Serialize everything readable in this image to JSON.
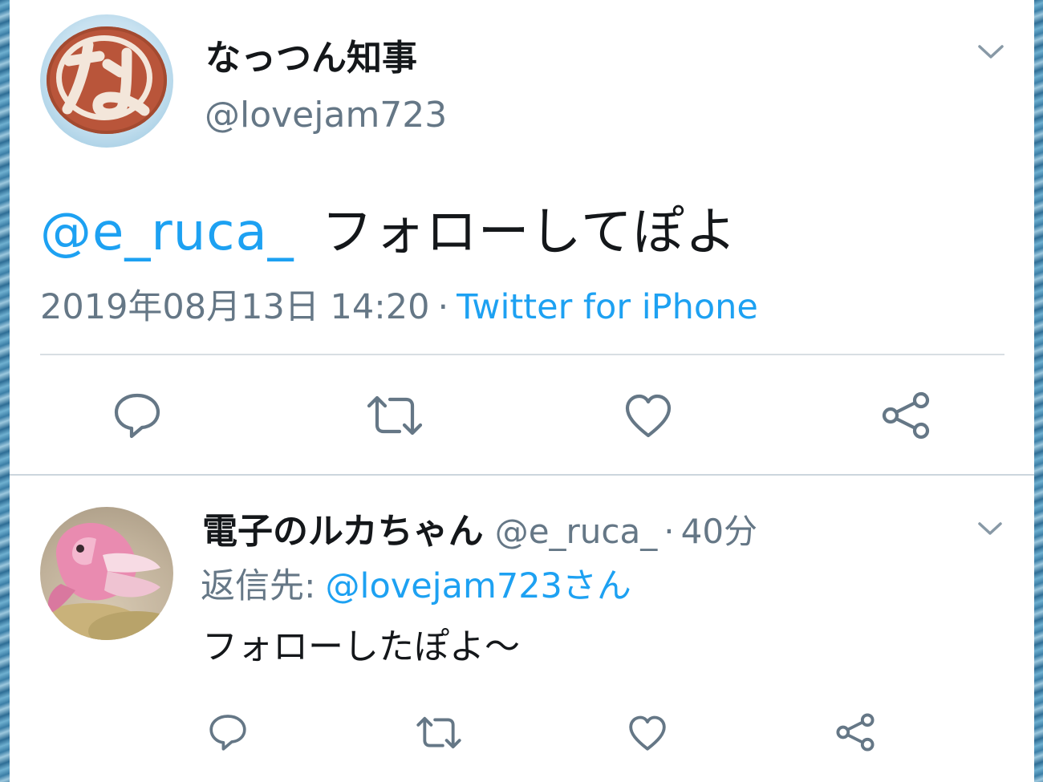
{
  "main_tweet": {
    "display_name": "なっつん知事",
    "handle": "@lovejam723",
    "avatar_glyph": "な",
    "mention": "@e_ruca_",
    "text": "フォローしてぽよ",
    "timestamp": "2019年08月13日 14:20",
    "separator": "·",
    "source": "Twitter for iPhone"
  },
  "reply_tweet": {
    "display_name": "電子のルカちゃん",
    "handle": "@e_ruca_",
    "separator": "·",
    "time": "40分",
    "reply_to_label": "返信先:",
    "reply_to_mention": "@lovejam723さん",
    "text": "フォローしたぽよ～"
  },
  "colors": {
    "accent": "#1da1f2",
    "text": "#14171a",
    "secondary": "#657786",
    "icon": "#657786",
    "divider": "#ccd6dd"
  },
  "icons": {
    "reply": "reply-icon",
    "retweet": "retweet-icon",
    "like": "heart-icon",
    "share": "share-icon",
    "menu": "chevron-down-icon"
  }
}
